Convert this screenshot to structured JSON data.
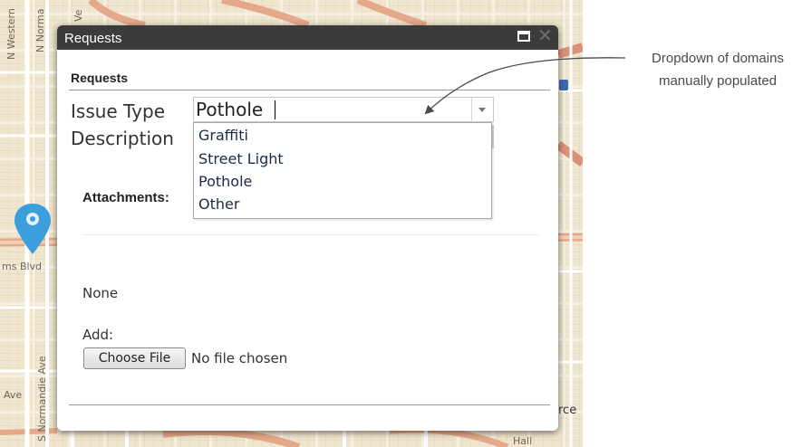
{
  "map": {
    "street_labels": [
      "N Western",
      "N Norma",
      "Ve",
      "ms Blvd",
      "S Normandie Ave",
      "Ave",
      "rce",
      "Hall"
    ]
  },
  "dialog": {
    "title": "Requests",
    "section_heading": "Requests",
    "issue_type_label": "Issue Type",
    "issue_type_value": "Pothole",
    "issue_type_options": [
      "Graffiti",
      "Street Light",
      "Pothole",
      "Other"
    ],
    "description_label": "Description",
    "attachments_label": "Attachments:",
    "attachments_value": "None",
    "add_label": "Add:",
    "choose_file_label": "Choose File",
    "file_status": "No file chosen",
    "close_glyph": "✕"
  },
  "callout": {
    "line1": "Dropdown of domains",
    "line2": "manually populated"
  },
  "colors": {
    "header_bg": "#3b3b3b",
    "pin": "#3a9fdc",
    "major_road": "#e4a98a",
    "map_bg": "#f0e6cf"
  },
  "icons": [
    "maximize-icon",
    "close-icon",
    "dropdown-arrow-icon",
    "map-pin-icon"
  ]
}
